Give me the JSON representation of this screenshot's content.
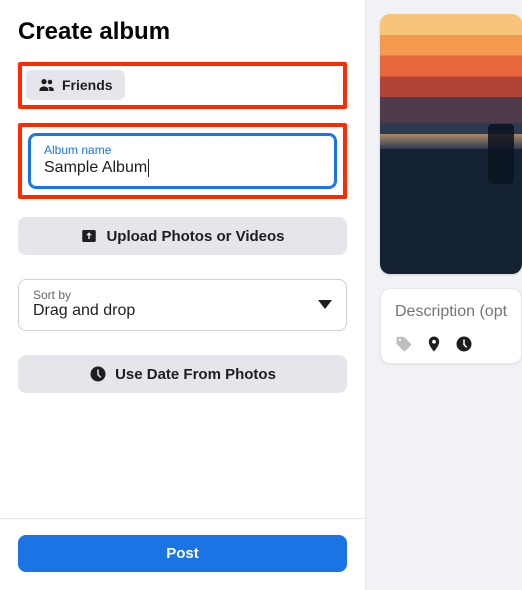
{
  "header": {
    "title": "Create album"
  },
  "privacy": {
    "label": "Friends"
  },
  "album": {
    "field_label": "Album name",
    "value": "Sample Album"
  },
  "upload_button": {
    "label": "Upload Photos or Videos"
  },
  "sort": {
    "label": "Sort by",
    "value": "Drag and drop"
  },
  "date_button": {
    "label": "Use Date From Photos"
  },
  "post_button": {
    "label": "Post"
  },
  "desc": {
    "placeholder": "Description (optional)"
  }
}
